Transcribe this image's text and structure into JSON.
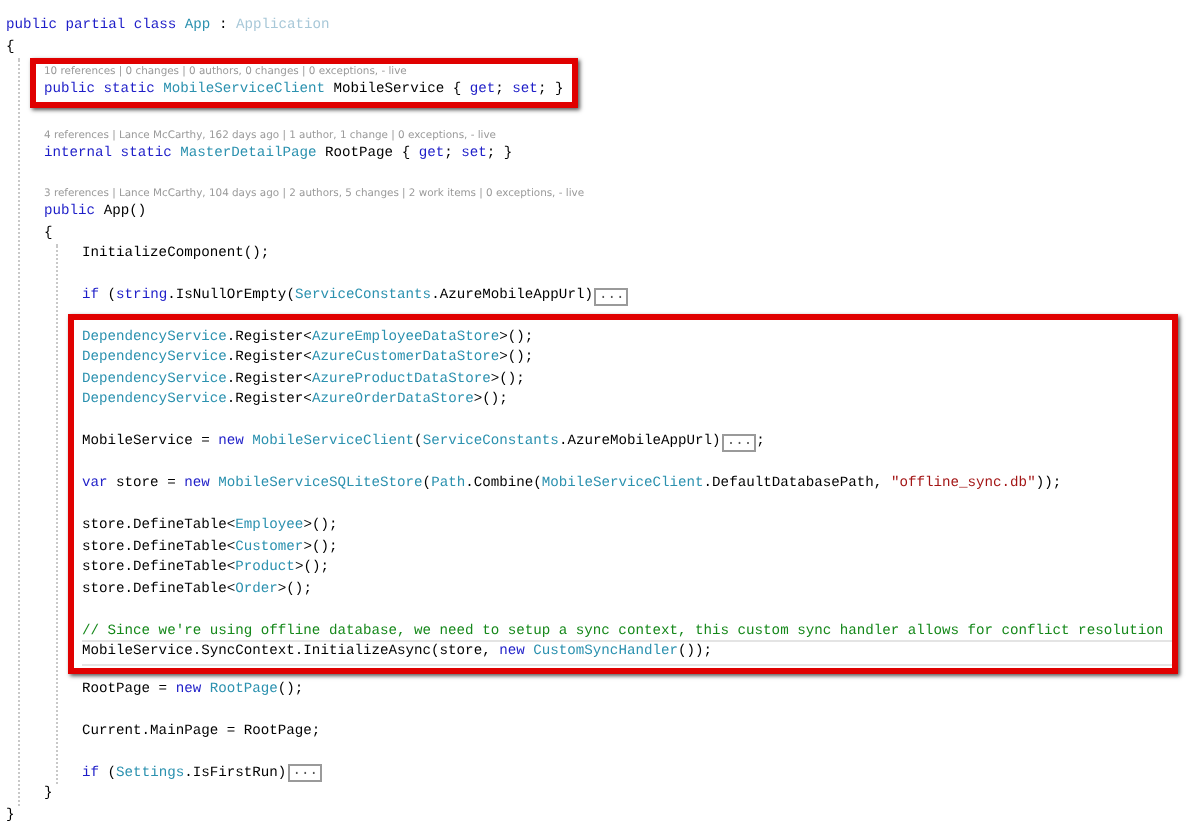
{
  "code": [
    {
      "kind": "line",
      "segments": [
        {
          "kind": "code",
          "tokens": [
            {
              "kind": "kw",
              "t": "public partial class "
            },
            {
              "kind": "type",
              "t": "App"
            },
            {
              "kind": "plain",
              "t": " : "
            },
            {
              "kind": "faded",
              "t": "Application"
            }
          ]
        }
      ]
    },
    {
      "kind": "line",
      "segments": [
        {
          "kind": "code",
          "tokens": [
            {
              "kind": "plain",
              "t": "{"
            }
          ]
        }
      ]
    },
    {
      "kind": "block",
      "children": [
        {
          "kind": "highlight",
          "children": [
            {
              "kind": "lens",
              "text": "10 references | 0 changes | 0 authors, 0 changes | 0 exceptions, - live"
            },
            {
              "kind": "line",
              "segments": [
                {
                  "kind": "code",
                  "tokens": [
                    {
                      "kind": "kw",
                      "t": "public static "
                    },
                    {
                      "kind": "type",
                      "t": "MobileServiceClient"
                    },
                    {
                      "kind": "plain",
                      "t": " MobileService { "
                    },
                    {
                      "kind": "kw",
                      "t": "get"
                    },
                    {
                      "kind": "plain",
                      "t": "; "
                    },
                    {
                      "kind": "kw",
                      "t": "set"
                    },
                    {
                      "kind": "plain",
                      "t": "; }"
                    }
                  ]
                }
              ]
            }
          ]
        },
        {
          "kind": "blank"
        },
        {
          "kind": "lens",
          "text": "4 references | Lance McCarthy, 162 days ago | 1 author, 1 change | 0 exceptions, - live"
        },
        {
          "kind": "line",
          "segments": [
            {
              "kind": "code",
              "tokens": [
                {
                  "kind": "kw",
                  "t": "internal static "
                },
                {
                  "kind": "type",
                  "t": "MasterDetailPage"
                },
                {
                  "kind": "plain",
                  "t": " RootPage { "
                },
                {
                  "kind": "kw",
                  "t": "get"
                },
                {
                  "kind": "plain",
                  "t": "; "
                },
                {
                  "kind": "kw",
                  "t": "set"
                },
                {
                  "kind": "plain",
                  "t": "; }"
                }
              ]
            }
          ]
        },
        {
          "kind": "blank"
        },
        {
          "kind": "lens",
          "text": "3 references | Lance McCarthy, 104 days ago | 2 authors, 5 changes | 2 work items | 0 exceptions, - live"
        },
        {
          "kind": "line",
          "segments": [
            {
              "kind": "code",
              "tokens": [
                {
                  "kind": "kw",
                  "t": "public "
                },
                {
                  "kind": "plain",
                  "t": "App()"
                }
              ]
            }
          ]
        },
        {
          "kind": "line",
          "segments": [
            {
              "kind": "code",
              "tokens": [
                {
                  "kind": "plain",
                  "t": "{"
                }
              ]
            }
          ]
        },
        {
          "kind": "block",
          "children": [
            {
              "kind": "line",
              "segments": [
                {
                  "kind": "code",
                  "tokens": [
                    {
                      "kind": "plain",
                      "t": "InitializeComponent();"
                    }
                  ]
                }
              ]
            },
            {
              "kind": "blank"
            },
            {
              "kind": "line",
              "segments": [
                {
                  "kind": "code",
                  "tokens": [
                    {
                      "kind": "kw",
                      "t": "if "
                    },
                    {
                      "kind": "plain",
                      "t": "("
                    },
                    {
                      "kind": "kw",
                      "t": "string"
                    },
                    {
                      "kind": "plain",
                      "t": ".IsNullOrEmpty("
                    },
                    {
                      "kind": "type",
                      "t": "ServiceConstants"
                    },
                    {
                      "kind": "plain",
                      "t": ".AzureMobileAppUrl)"
                    }
                  ]
                },
                {
                  "kind": "fold",
                  "label": "..."
                }
              ]
            },
            {
              "kind": "highlight",
              "children": [
                {
                  "kind": "line",
                  "segments": [
                    {
                      "kind": "code",
                      "tokens": [
                        {
                          "kind": "type",
                          "t": "DependencyService"
                        },
                        {
                          "kind": "plain",
                          "t": ".Register<"
                        },
                        {
                          "kind": "type",
                          "t": "AzureEmployeeDataStore"
                        },
                        {
                          "kind": "plain",
                          "t": ">();"
                        }
                      ]
                    }
                  ]
                },
                {
                  "kind": "line",
                  "segments": [
                    {
                      "kind": "code",
                      "tokens": [
                        {
                          "kind": "type",
                          "t": "DependencyService"
                        },
                        {
                          "kind": "plain",
                          "t": ".Register<"
                        },
                        {
                          "kind": "type",
                          "t": "AzureCustomerDataStore"
                        },
                        {
                          "kind": "plain",
                          "t": ">();"
                        }
                      ]
                    }
                  ]
                },
                {
                  "kind": "line",
                  "segments": [
                    {
                      "kind": "code",
                      "tokens": [
                        {
                          "kind": "type",
                          "t": "DependencyService"
                        },
                        {
                          "kind": "plain",
                          "t": ".Register<"
                        },
                        {
                          "kind": "type",
                          "t": "AzureProductDataStore"
                        },
                        {
                          "kind": "plain",
                          "t": ">();"
                        }
                      ]
                    }
                  ]
                },
                {
                  "kind": "line",
                  "segments": [
                    {
                      "kind": "code",
                      "tokens": [
                        {
                          "kind": "type",
                          "t": "DependencyService"
                        },
                        {
                          "kind": "plain",
                          "t": ".Register<"
                        },
                        {
                          "kind": "type",
                          "t": "AzureOrderDataStore"
                        },
                        {
                          "kind": "plain",
                          "t": ">();"
                        }
                      ]
                    }
                  ]
                },
                {
                  "kind": "blank"
                },
                {
                  "kind": "line",
                  "segments": [
                    {
                      "kind": "code",
                      "tokens": [
                        {
                          "kind": "plain",
                          "t": "MobileService = "
                        },
                        {
                          "kind": "kw",
                          "t": "new "
                        },
                        {
                          "kind": "type",
                          "t": "MobileServiceClient"
                        },
                        {
                          "kind": "plain",
                          "t": "("
                        },
                        {
                          "kind": "type",
                          "t": "ServiceConstants"
                        },
                        {
                          "kind": "plain",
                          "t": ".AzureMobileAppUrl)"
                        }
                      ]
                    },
                    {
                      "kind": "fold",
                      "label": "..."
                    },
                    {
                      "kind": "code",
                      "tokens": [
                        {
                          "kind": "plain",
                          "t": ";"
                        }
                      ]
                    }
                  ]
                },
                {
                  "kind": "blank"
                },
                {
                  "kind": "line",
                  "segments": [
                    {
                      "kind": "code",
                      "tokens": [
                        {
                          "kind": "kw",
                          "t": "var "
                        },
                        {
                          "kind": "plain",
                          "t": "store = "
                        },
                        {
                          "kind": "kw",
                          "t": "new "
                        },
                        {
                          "kind": "type",
                          "t": "MobileServiceSQLiteStore"
                        },
                        {
                          "kind": "plain",
                          "t": "("
                        },
                        {
                          "kind": "type",
                          "t": "Path"
                        },
                        {
                          "kind": "plain",
                          "t": ".Combine("
                        },
                        {
                          "kind": "type",
                          "t": "MobileServiceClient"
                        },
                        {
                          "kind": "plain",
                          "t": ".DefaultDatabasePath, "
                        },
                        {
                          "kind": "str",
                          "t": "\"offline_sync.db\""
                        },
                        {
                          "kind": "plain",
                          "t": "));"
                        }
                      ]
                    }
                  ]
                },
                {
                  "kind": "blank"
                },
                {
                  "kind": "line",
                  "segments": [
                    {
                      "kind": "code",
                      "tokens": [
                        {
                          "kind": "plain",
                          "t": "store.DefineTable<"
                        },
                        {
                          "kind": "type",
                          "t": "Employee"
                        },
                        {
                          "kind": "plain",
                          "t": ">();"
                        }
                      ]
                    }
                  ]
                },
                {
                  "kind": "line",
                  "segments": [
                    {
                      "kind": "code",
                      "tokens": [
                        {
                          "kind": "plain",
                          "t": "store.DefineTable<"
                        },
                        {
                          "kind": "type",
                          "t": "Customer"
                        },
                        {
                          "kind": "plain",
                          "t": ">();"
                        }
                      ]
                    }
                  ]
                },
                {
                  "kind": "line",
                  "segments": [
                    {
                      "kind": "code",
                      "tokens": [
                        {
                          "kind": "plain",
                          "t": "store.DefineTable<"
                        },
                        {
                          "kind": "type",
                          "t": "Product"
                        },
                        {
                          "kind": "plain",
                          "t": ">();"
                        }
                      ]
                    }
                  ]
                },
                {
                  "kind": "line",
                  "segments": [
                    {
                      "kind": "code",
                      "tokens": [
                        {
                          "kind": "plain",
                          "t": "store.DefineTable<"
                        },
                        {
                          "kind": "type",
                          "t": "Order"
                        },
                        {
                          "kind": "plain",
                          "t": ">();"
                        }
                      ]
                    }
                  ]
                },
                {
                  "kind": "blank"
                },
                {
                  "kind": "line",
                  "segments": [
                    {
                      "kind": "code",
                      "tokens": [
                        {
                          "kind": "comment",
                          "t": "// Since we're using offline database, we need to setup a sync context, this custom sync handler allows for conflict resolution"
                        }
                      ]
                    }
                  ]
                },
                {
                  "kind": "line",
                  "current": true,
                  "segments": [
                    {
                      "kind": "code",
                      "tokens": [
                        {
                          "kind": "plain",
                          "t": "MobileService.SyncContext.InitializeAsync(store, "
                        },
                        {
                          "kind": "kw",
                          "t": "new "
                        },
                        {
                          "kind": "type",
                          "t": "CustomSyncHandler"
                        },
                        {
                          "kind": "plain",
                          "t": "());"
                        }
                      ]
                    }
                  ]
                }
              ]
            },
            {
              "kind": "line",
              "segments": [
                {
                  "kind": "code",
                  "tokens": [
                    {
                      "kind": "plain",
                      "t": "RootPage = "
                    },
                    {
                      "kind": "kw",
                      "t": "new "
                    },
                    {
                      "kind": "type",
                      "t": "RootPage"
                    },
                    {
                      "kind": "plain",
                      "t": "();"
                    }
                  ]
                }
              ]
            },
            {
              "kind": "blank"
            },
            {
              "kind": "line",
              "segments": [
                {
                  "kind": "code",
                  "tokens": [
                    {
                      "kind": "plain",
                      "t": "Current.MainPage = RootPage;"
                    }
                  ]
                }
              ]
            },
            {
              "kind": "blank"
            },
            {
              "kind": "line",
              "segments": [
                {
                  "kind": "code",
                  "tokens": [
                    {
                      "kind": "kw",
                      "t": "if "
                    },
                    {
                      "kind": "plain",
                      "t": "("
                    },
                    {
                      "kind": "type",
                      "t": "Settings"
                    },
                    {
                      "kind": "plain",
                      "t": ".IsFirstRun)"
                    }
                  ]
                },
                {
                  "kind": "fold",
                  "label": "..."
                }
              ]
            }
          ]
        },
        {
          "kind": "line",
          "segments": [
            {
              "kind": "code",
              "tokens": [
                {
                  "kind": "plain",
                  "t": "}"
                }
              ]
            }
          ]
        }
      ]
    },
    {
      "kind": "line",
      "segments": [
        {
          "kind": "code",
          "tokens": [
            {
              "kind": "plain",
              "t": "}"
            }
          ]
        }
      ]
    }
  ]
}
